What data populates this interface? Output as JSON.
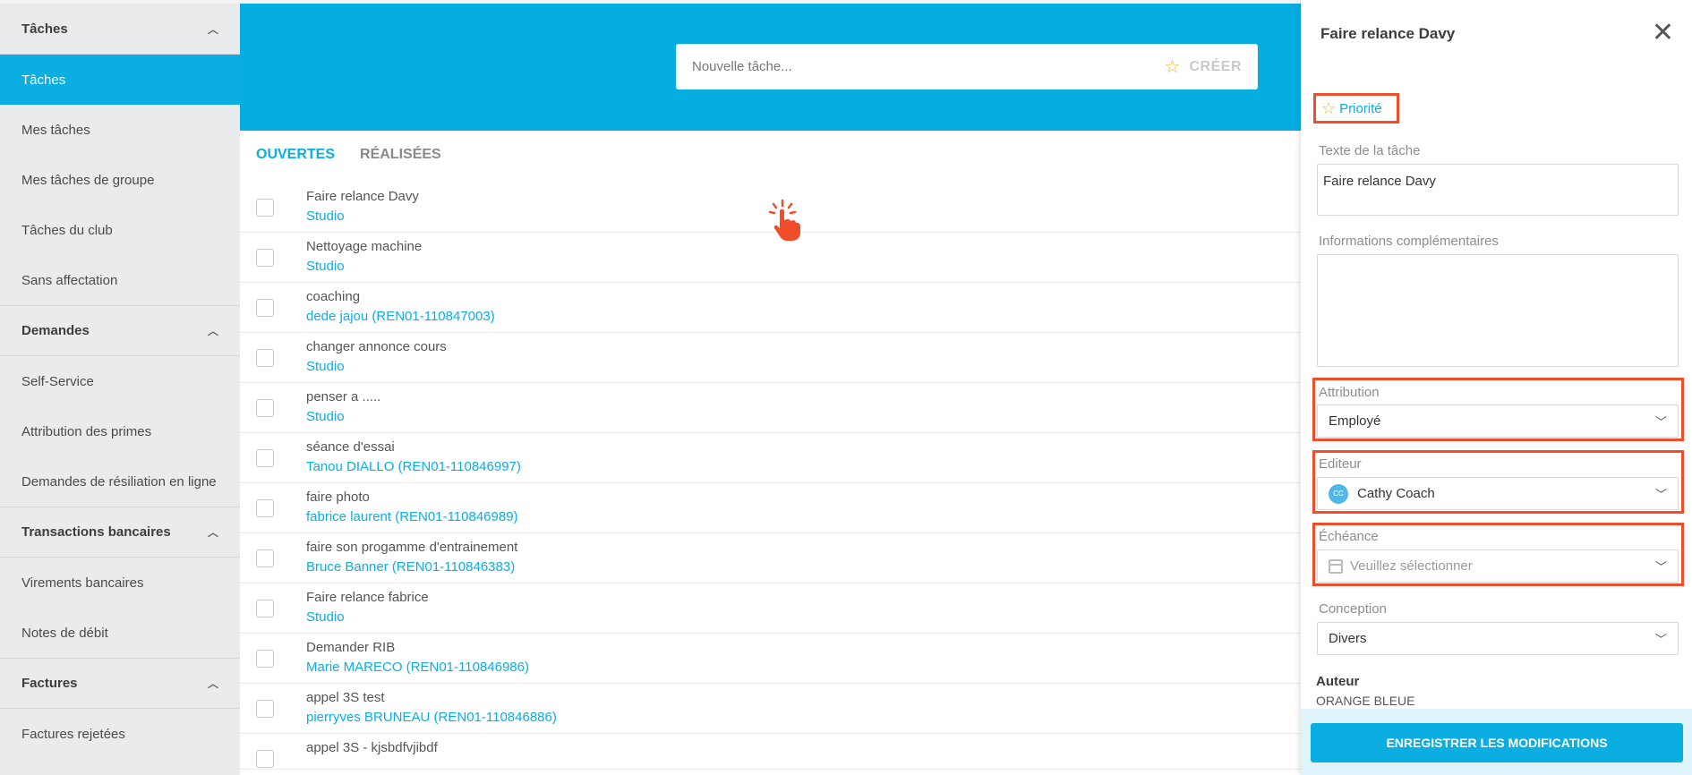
{
  "sidebar": {
    "sections": [
      {
        "title": "Tâches",
        "items": [
          "Tâches",
          "Mes tâches",
          "Mes tâches de groupe",
          "Tâches du club",
          "Sans affectation"
        ]
      },
      {
        "title": "Demandes",
        "items": [
          "Self-Service",
          "Attribution des primes",
          "Demandes de résiliation en ligne"
        ]
      },
      {
        "title": "Transactions bancaires",
        "items": [
          "Virements bancaires",
          "Notes de débit"
        ]
      },
      {
        "title": "Factures",
        "items": [
          "Factures rejetées"
        ]
      }
    ]
  },
  "banner": {
    "placeholder": "Nouvelle tâche...",
    "create_label": "CRÉER"
  },
  "tabs": {
    "open": "OUVERTES",
    "done": "RÉALISÉES"
  },
  "tasks": [
    {
      "title": "Faire relance Davy",
      "sub": "Studio"
    },
    {
      "title": "Nettoyage machine",
      "sub": "Studio"
    },
    {
      "title": "coaching",
      "sub": "dede jajou (REN01-110847003)"
    },
    {
      "title": "changer annonce cours",
      "sub": "Studio"
    },
    {
      "title": "penser a .....",
      "sub": "Studio"
    },
    {
      "title": "séance d'essai",
      "sub": "Tanou DIALLO (REN01-110846997)"
    },
    {
      "title": "faire photo",
      "sub": "fabrice laurent (REN01-110846989)"
    },
    {
      "title": "faire son progamme d'entrainement",
      "sub": "Bruce Banner (REN01-110846383)"
    },
    {
      "title": "Faire relance fabrice",
      "sub": "Studio"
    },
    {
      "title": "Demander RIB",
      "sub": "Marie MARECO (REN01-110846986)"
    },
    {
      "title": "appel 3S test",
      "sub": "pierryves BRUNEAU (REN01-110846886)"
    },
    {
      "title": "appel 3S - kjsbdfvjibdf",
      "sub": ""
    }
  ],
  "panel": {
    "title": "Faire relance Davy",
    "priority_label": "Priorité",
    "task_text_label": "Texte de la tâche",
    "task_text_value": "Faire relance Davy",
    "extra_info_label": "Informations complémentaires",
    "extra_info_value": "",
    "attribution_label": "Attribution",
    "attribution_value": "Employé",
    "editor_label": "Editeur",
    "editor_initials": "CC",
    "editor_value": "Cathy Coach",
    "deadline_label": "Échéance",
    "deadline_placeholder": "Veuillez sélectionner",
    "conception_label": "Conception",
    "conception_value": "Divers",
    "author_label": "Auteur",
    "author_value": "ORANGE BLEUE",
    "save_label": "ENREGISTRER LES MODIFICATIONS"
  },
  "colors": {
    "accent": "#0aaee0",
    "highlight": "#f04e2a",
    "star": "#f2b632"
  }
}
